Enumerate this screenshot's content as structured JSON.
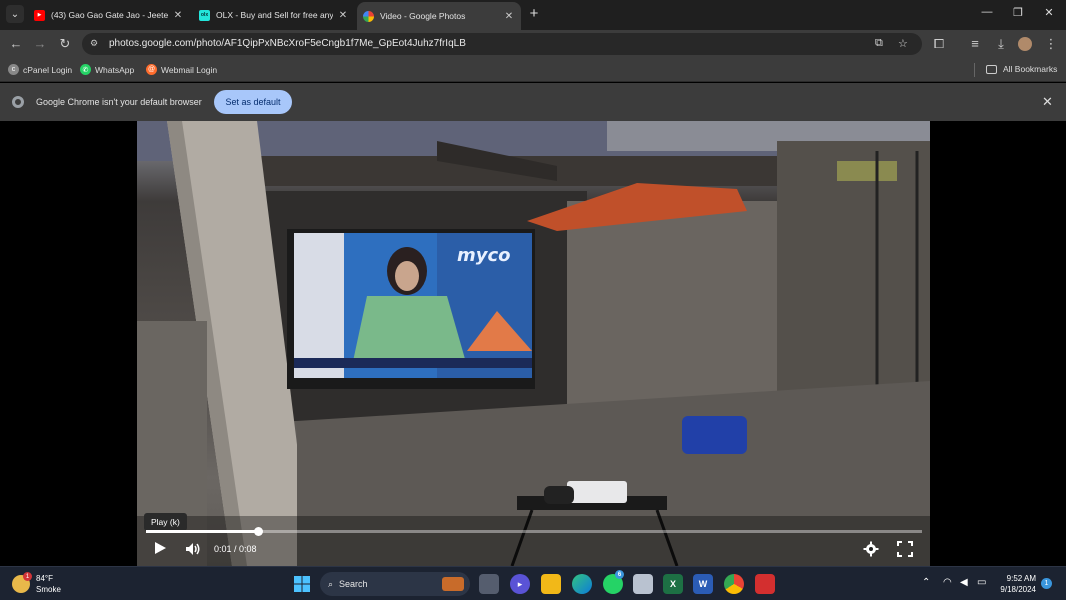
{
  "tabs": [
    {
      "title": "(43) Gao Gao Gate Jao - Jeeten",
      "favicon": "youtube-icon",
      "color": "#ff0000"
    },
    {
      "title": "OLX - Buy and Sell for free anyw",
      "favicon": "olx-icon",
      "color": "#23e5db"
    },
    {
      "title": "Video - Google Photos",
      "favicon": "google-photos-icon",
      "color": "#fbbc04"
    }
  ],
  "address": {
    "url": "photos.google.com/photo/AF1QipPxNBcXroF5eCngb1f7Me_GpEot4Juhz7frIqLB"
  },
  "bookmarks": [
    {
      "label": "cPanel Login"
    },
    {
      "label": "WhatsApp"
    },
    {
      "label": "Webmail Login"
    }
  ],
  "all_bookmarks": "All Bookmarks",
  "infobar": {
    "message": "Google Chrome isn't your default browser",
    "button": "Set as default"
  },
  "video": {
    "tooltip": "Play (k)",
    "time": "0:01 / 0:08",
    "progress": 0.145,
    "tv_brand": "myco"
  },
  "taskbar": {
    "weather_temp": "84°F",
    "weather_desc": "Smoke",
    "weather_badge": "1",
    "search": "Search",
    "time": "9:52 AM",
    "date": "9/18/2024",
    "notifications": "1",
    "whatsapp_badge": "6"
  }
}
